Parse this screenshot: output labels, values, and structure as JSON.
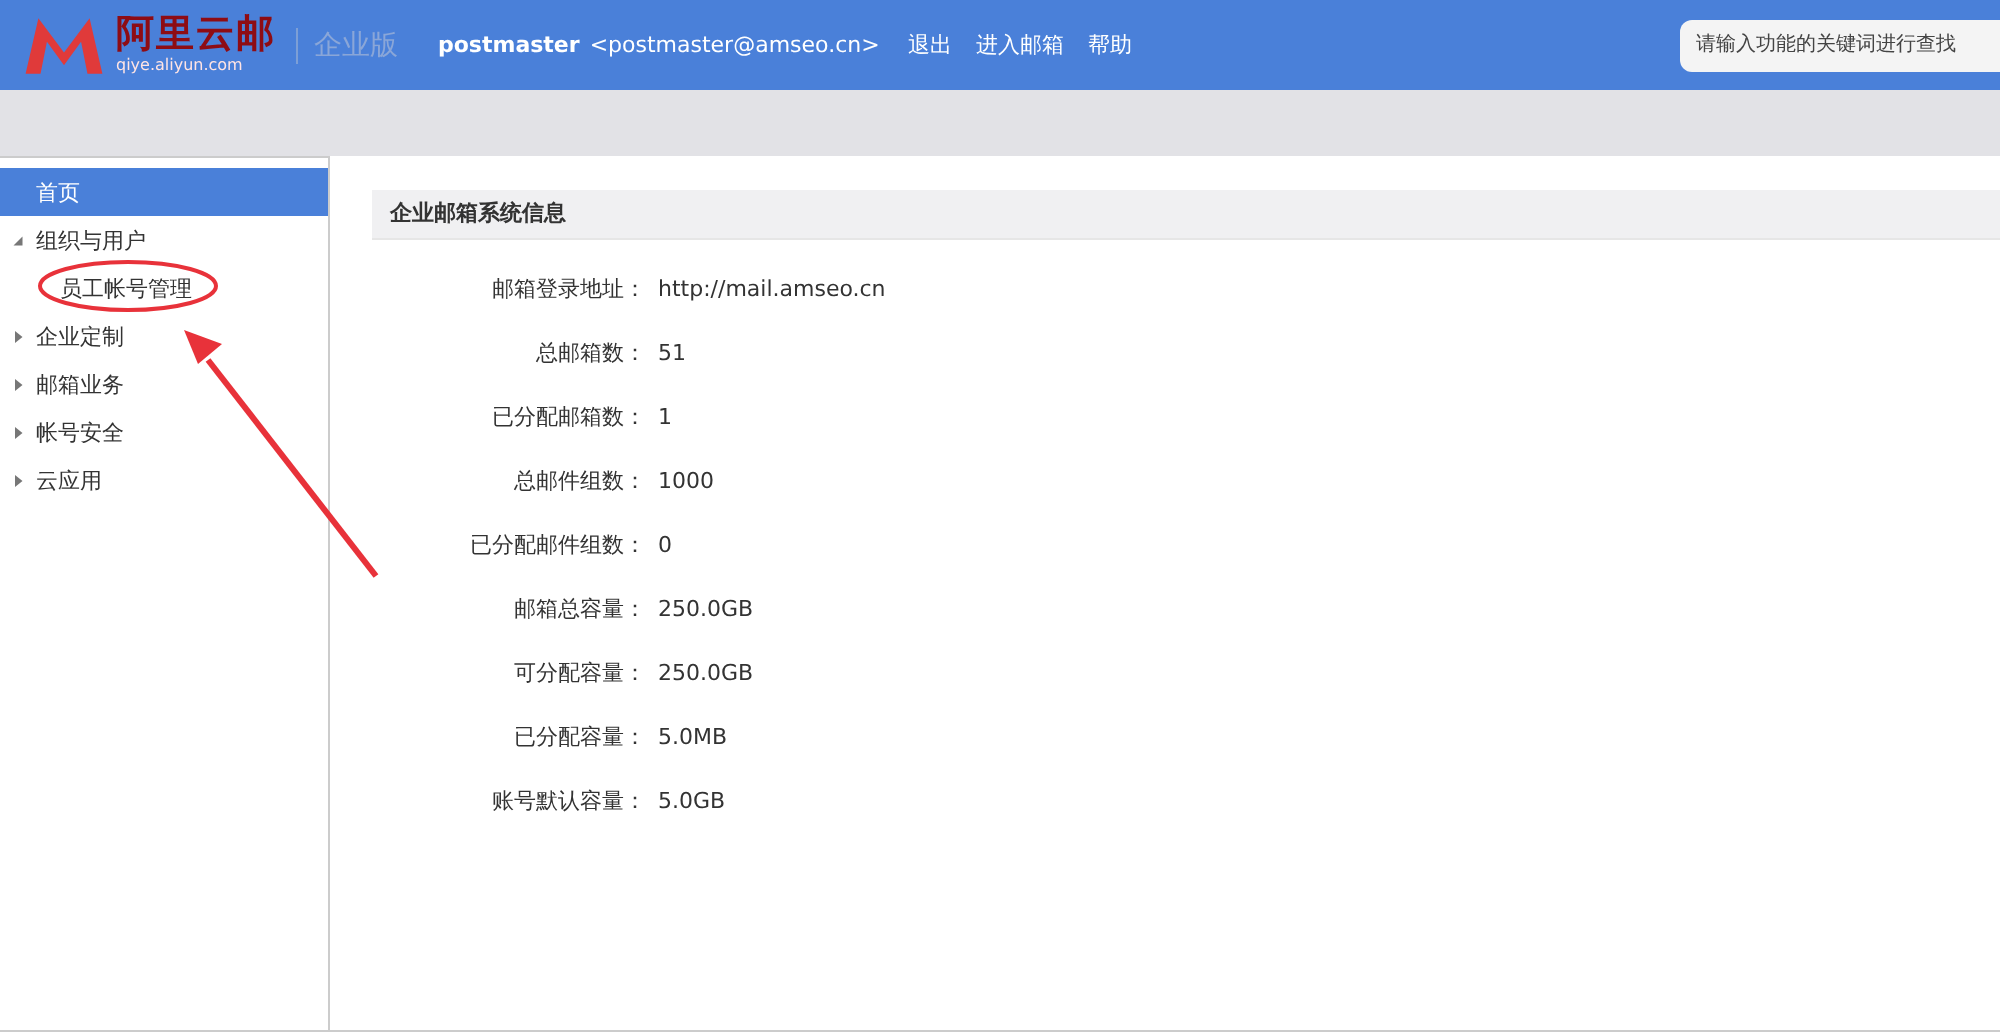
{
  "header": {
    "logo_text": "阿里云邮",
    "logo_url": "qiye.aliyun.com",
    "edition": "企业版",
    "user_name": "postmaster",
    "user_email": "<postmaster@amseo.cn>",
    "links": [
      "退出",
      "进入邮箱",
      "帮助"
    ],
    "search": {
      "placeholder": "请输入功能的关键词进行查找"
    }
  },
  "sidebar": {
    "items": [
      {
        "label": "首页",
        "selected": true
      },
      {
        "label": "组织与用户",
        "selected": false,
        "expanded": true,
        "children": [
          {
            "label": "员工帐号管理",
            "selected": false
          }
        ]
      },
      {
        "label": "企业定制",
        "selected": false,
        "expanded": false
      },
      {
        "label": "邮箱业务",
        "selected": false,
        "expanded": false
      },
      {
        "label": "帐号安全",
        "selected": false,
        "expanded": false
      },
      {
        "label": "云应用",
        "selected": false,
        "expanded": false
      }
    ]
  },
  "panel": {
    "title": "企业邮箱系统信息",
    "rows": [
      {
        "label": "邮箱登录地址：",
        "value": "http://mail.amseo.cn"
      },
      {
        "label": "总邮箱数：",
        "value": "51"
      },
      {
        "label": "已分配邮箱数：",
        "value": "1"
      },
      {
        "label": "总邮件组数：",
        "value": "1000"
      },
      {
        "label": "已分配邮件组数：",
        "value": "0"
      },
      {
        "label": "邮箱总容量：",
        "value": "250.0GB"
      },
      {
        "label": "可分配容量：",
        "value": "250.0GB"
      },
      {
        "label": "已分配容量：",
        "value": "5.0MB"
      },
      {
        "label": "账号默认容量：",
        "value": "5.0GB"
      }
    ]
  }
}
